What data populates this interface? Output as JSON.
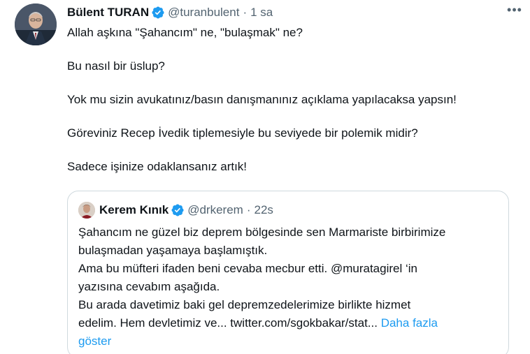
{
  "tweet": {
    "author_name": "Bülent TURAN",
    "author_handle": "@turanbulent",
    "separator": "·",
    "time": "1 sa",
    "more_label": "•••",
    "paragraphs": [
      "Allah aşkına \"Şahancım\" ne, \"bulaşmak\" ne?",
      "Bu nasıl bir üslup?",
      "Yok mu sizin avukatınız/basın danışmanınız açıklama yapılacaksa yapsın!",
      "Göreviniz Recep İvedik tiplemesiyle bu seviyede bir polemik midir?",
      "Sadece işinize odaklansanız artık!"
    ]
  },
  "quoted": {
    "author_name": "Kerem Kınık",
    "author_handle": "@drkerem",
    "separator": "·",
    "time": "22s",
    "lines": [
      "Şahancım ne güzel biz deprem bölgesinde sen Marmariste birbirimize",
      "bulaşmadan yaşamaya başlamıştık.",
      "Ama bu müfteri ifaden beni cevaba mecbur etti. @muratagirel ‘in",
      "yazısına cevabım aşağıda.",
      "Bu arada davetimiz baki gel depremzedelerimize birlikte hizmet"
    ],
    "last_line_text": "edelim. Hem devletimiz ve... twitter.com/sgokbakar/stat... ",
    "show_more_part1": "Daha fazla",
    "show_more_part2": "göster"
  },
  "colors": {
    "text": "#0f1419",
    "secondary": "#536471",
    "link": "#1d9bf0",
    "border": "#cfd9de",
    "verified": "#1d9bf0"
  },
  "icons": {
    "verified": "verified-badge-icon",
    "more": "more-horizontal-icon"
  }
}
